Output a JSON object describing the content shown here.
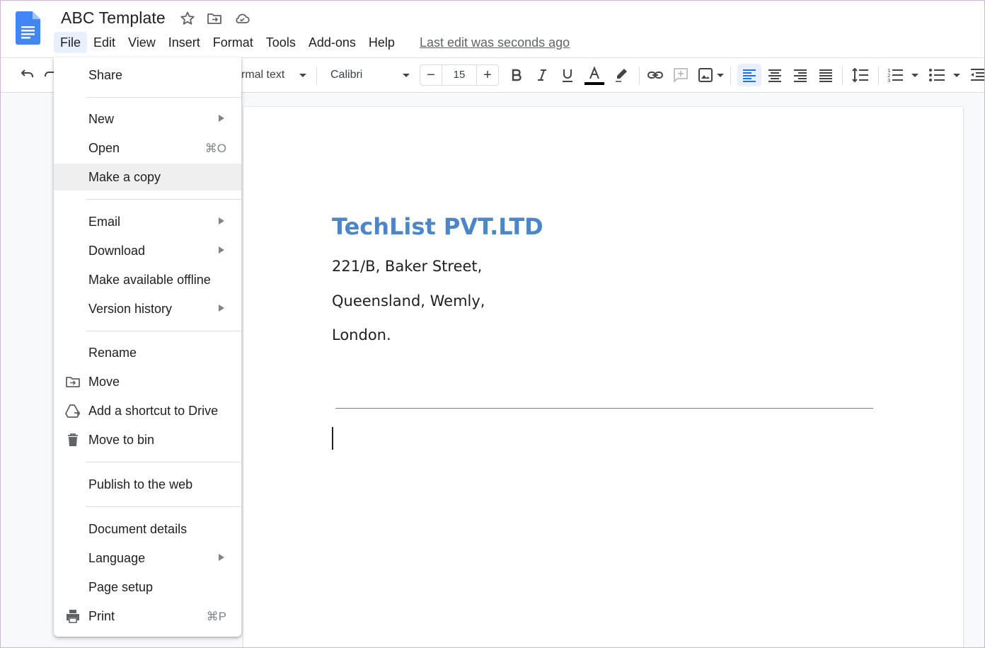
{
  "header": {
    "title": "ABC Template",
    "menus": [
      "File",
      "Edit",
      "View",
      "Insert",
      "Format",
      "Tools",
      "Add-ons",
      "Help"
    ],
    "last_edit": "Last edit was seconds ago"
  },
  "toolbar": {
    "style": "rmal text",
    "font": "Calibri",
    "font_size": "15",
    "decrease": "−",
    "increase": "+"
  },
  "file_menu": {
    "items": [
      {
        "label": "Share"
      },
      {
        "label": "New"
      },
      {
        "label": "Open",
        "shortcut": "⌘O"
      },
      {
        "label": "Make a copy"
      },
      {
        "label": "Email"
      },
      {
        "label": "Download"
      },
      {
        "label": "Make available offline"
      },
      {
        "label": "Version history"
      },
      {
        "label": "Rename"
      },
      {
        "label": "Move"
      },
      {
        "label": "Add a shortcut to Drive"
      },
      {
        "label": "Move to bin"
      },
      {
        "label": "Publish to the web"
      },
      {
        "label": "Document details"
      },
      {
        "label": "Language"
      },
      {
        "label": "Page setup"
      },
      {
        "label": "Print",
        "shortcut": "⌘P"
      }
    ]
  },
  "document": {
    "company": "TechList PVT.LTD",
    "address_lines": [
      "221/B, Baker Street,",
      "Queensland, Wemly,",
      "London."
    ]
  },
  "colors": {
    "accent": "#1a73e8",
    "heading": "#4a86c8",
    "menu_active": "#e8f0fe"
  }
}
